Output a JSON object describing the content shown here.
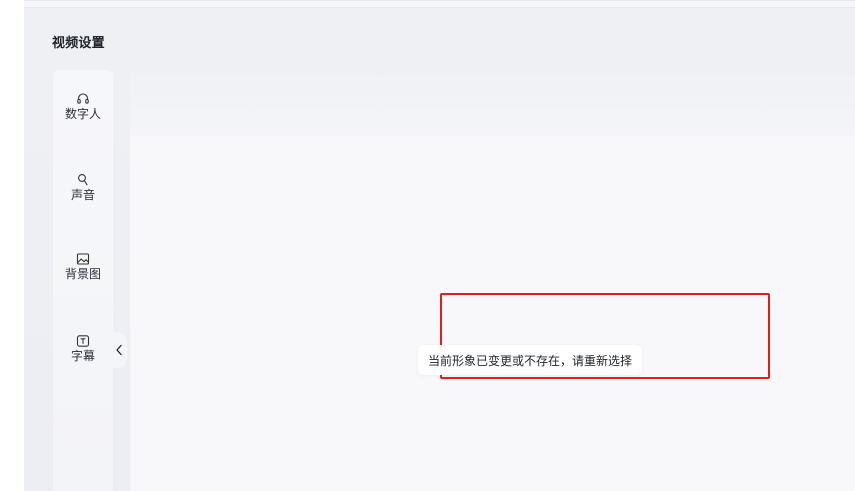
{
  "page": {
    "title": "视频设置"
  },
  "sidebar": {
    "items": [
      {
        "label": "数字人",
        "icon": "headset-icon"
      },
      {
        "label": "声音",
        "icon": "microphone-icon"
      },
      {
        "label": "背景图",
        "icon": "image-icon"
      },
      {
        "label": "字幕",
        "icon": "text-box-icon"
      }
    ],
    "collapse_icon": "chevron-left-icon"
  },
  "notice": {
    "message": "当前形象已变更或不存在，请重新选择"
  },
  "colors": {
    "highlight_border": "#e21f1f",
    "background": "#eef0f4",
    "panel": "#f8f8fa",
    "text": "#1f2329"
  }
}
